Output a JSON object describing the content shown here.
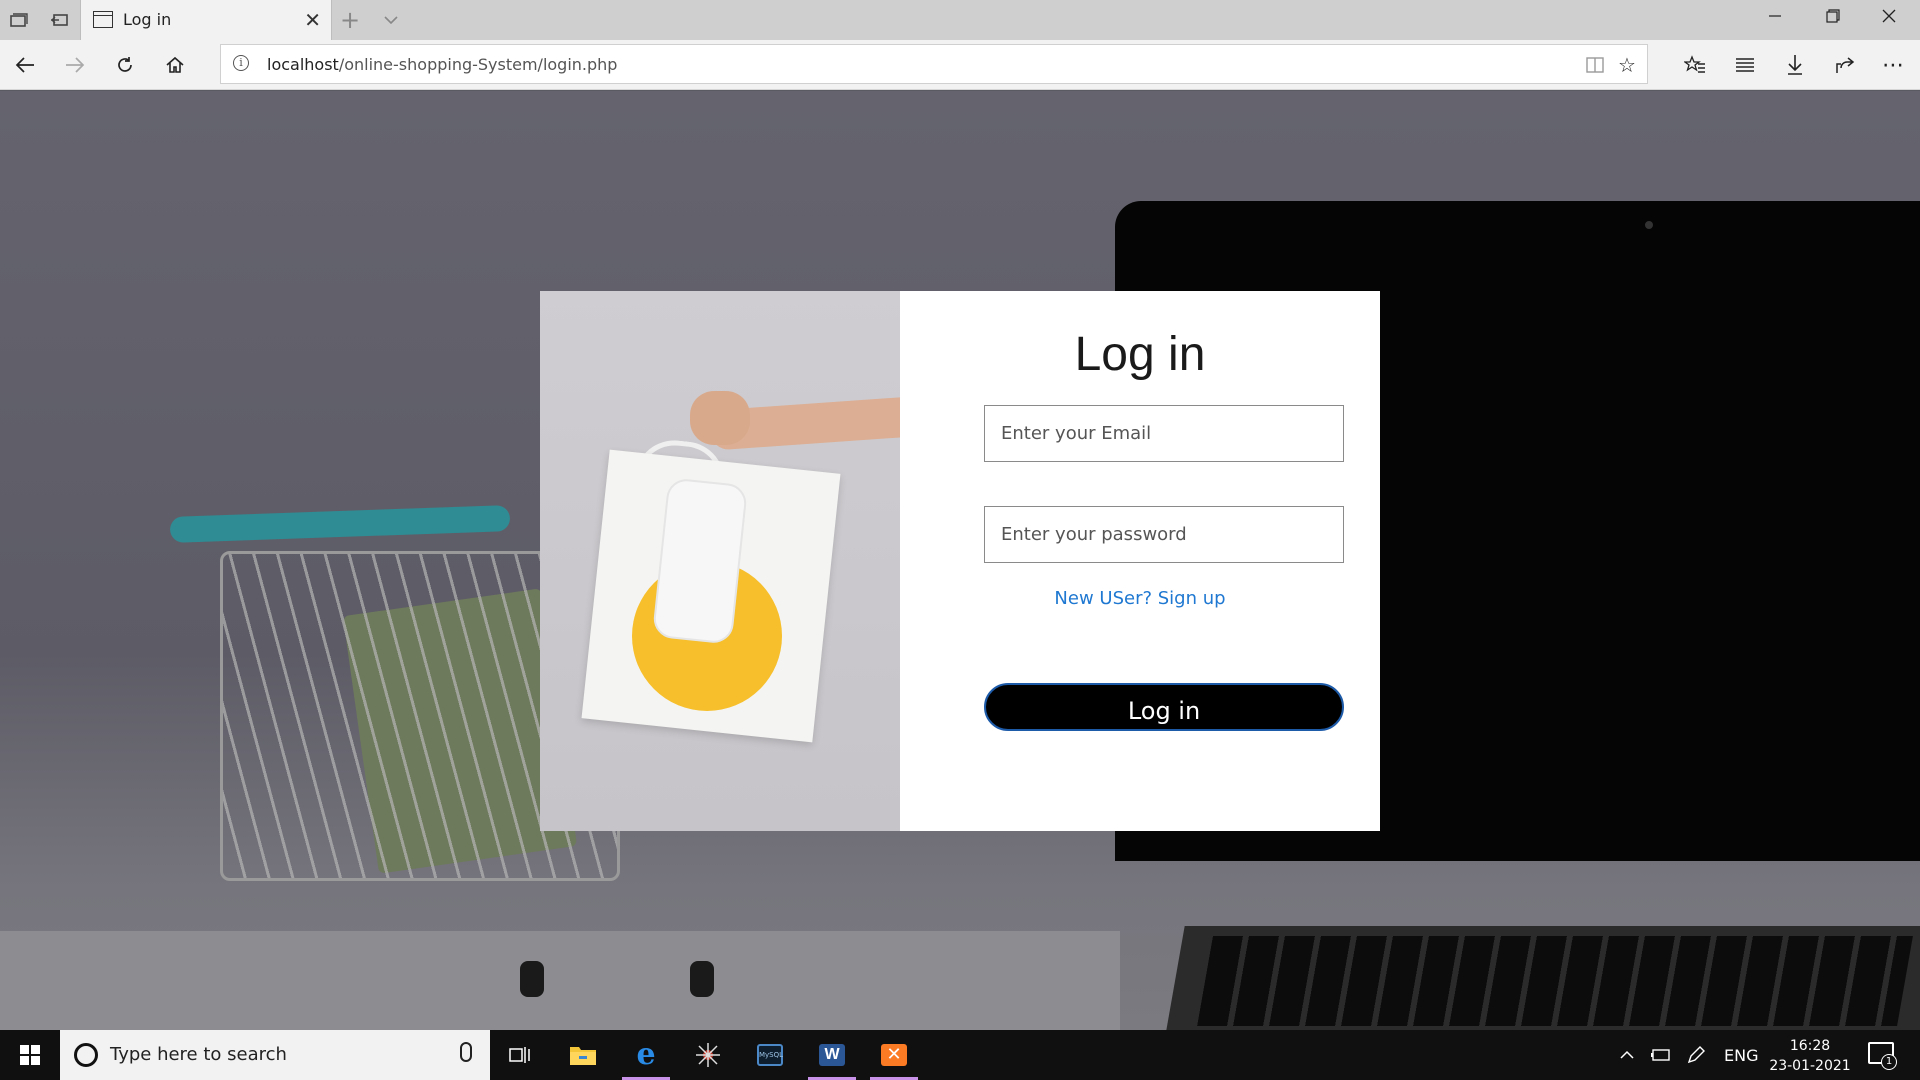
{
  "browser": {
    "tab": {
      "title": "Log in",
      "icon": "page-icon"
    },
    "address": {
      "host": "localhost",
      "path": "/online-shopping-System/login.php"
    }
  },
  "login": {
    "title": "Log in",
    "email_placeholder": "Enter your Email",
    "password_placeholder": "Enter your password",
    "signup_link": "New USer? Sign up",
    "submit_label": "Log in"
  },
  "taskbar": {
    "search_placeholder": "Type here to search",
    "apps": [
      "task-view-icon",
      "file-explorer-icon",
      "edge-icon",
      "spider-icon",
      "mysql-workbench-icon",
      "word-icon",
      "xampp-icon"
    ],
    "language": "ENG",
    "time": "16:28",
    "date": "23-01-2021",
    "notification_count": "1"
  },
  "colors": {
    "link": "#1f78d1",
    "button_bg": "#000000",
    "accent_circle": "#f6bf2b",
    "taskbar": "#101010"
  }
}
